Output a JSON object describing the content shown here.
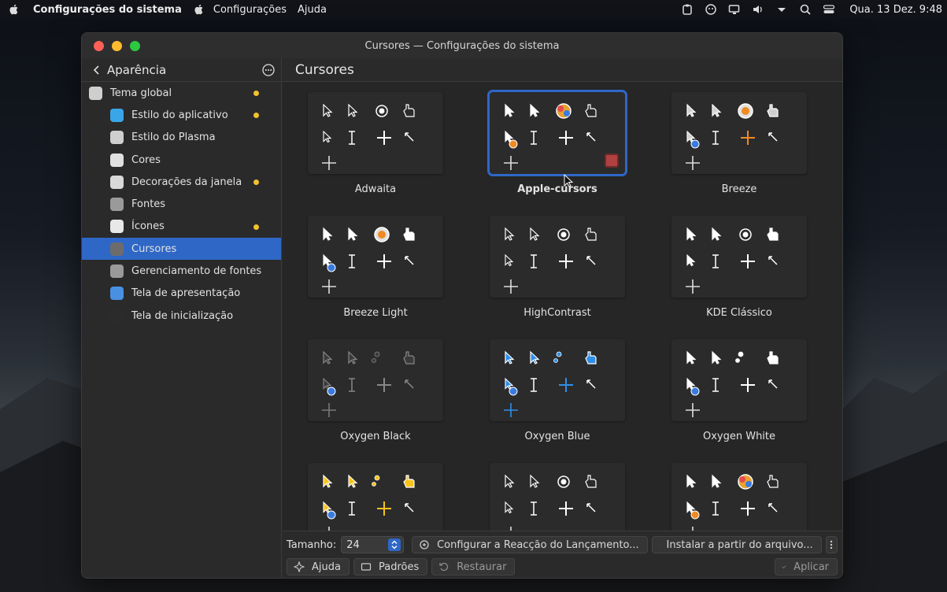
{
  "menubar": {
    "app_name": "Configurações do sistema",
    "menus": [
      "Configurações",
      "Ajuda"
    ],
    "clock": "Qua. 13 Dez. 9:48"
  },
  "window": {
    "title": "Cursores — Configurações do sistema"
  },
  "sidebar": {
    "back_label": "Aparência",
    "items": [
      {
        "label": "Tema global",
        "icon": "global-theme-icon",
        "color": "#cfcfcf",
        "dot": true,
        "level": 0
      },
      {
        "label": "Estilo do aplicativo",
        "icon": "app-style-icon",
        "color": "#3aa6e8",
        "dot": true,
        "level": 1
      },
      {
        "label": "Estilo do Plasma",
        "icon": "plasma-style-icon",
        "color": "#cfcfcf",
        "dot": false,
        "level": 1
      },
      {
        "label": "Cores",
        "icon": "colors-icon",
        "color": "#e0e0e0",
        "dot": false,
        "level": 1
      },
      {
        "label": "Decorações da janela",
        "icon": "window-decoration-icon",
        "color": "#d9d9d9",
        "dot": true,
        "level": 1
      },
      {
        "label": "Fontes",
        "icon": "fonts-icon",
        "color": "#9a9a9a",
        "dot": false,
        "level": 1
      },
      {
        "label": "Ícones",
        "icon": "icons-icon",
        "color": "#e8e8e8",
        "dot": true,
        "level": 1
      },
      {
        "label": "Cursores",
        "icon": "cursors-icon",
        "color": "#6c6c6c",
        "dot": false,
        "level": 1,
        "active": true
      },
      {
        "label": "Gerenciamento de fontes",
        "icon": "font-management-icon",
        "color": "#9a9a9a",
        "dot": false,
        "level": 1
      },
      {
        "label": "Tela de apresentação",
        "icon": "splash-screen-icon",
        "color": "#4a90e2",
        "dot": false,
        "level": 1
      },
      {
        "label": "Tela de inicialização",
        "icon": "boot-screen-icon",
        "color": "#2b2b2b",
        "dot": false,
        "level": 1
      }
    ]
  },
  "main": {
    "heading": "Cursores",
    "themes": [
      {
        "name": "Adwaita",
        "style": "outline",
        "accent": "#ffffff"
      },
      {
        "name": "Apple-cursors",
        "style": "apple",
        "accent": "#ffffff",
        "selected": true
      },
      {
        "name": "Breeze",
        "style": "breeze",
        "accent": "#cfcfcf"
      },
      {
        "name": "Breeze Light",
        "style": "breeze-light",
        "accent": "#ffffff"
      },
      {
        "name": "HighContrast",
        "style": "outline",
        "accent": "#ffffff"
      },
      {
        "name": "KDE Clássico",
        "style": "classic",
        "accent": "#ffffff"
      },
      {
        "name": "Oxygen Black",
        "style": "oxygen",
        "accent": "#3a3a3a"
      },
      {
        "name": "Oxygen Blue",
        "style": "oxygen",
        "accent": "#2f8ee8"
      },
      {
        "name": "Oxygen White",
        "style": "oxygen",
        "accent": "#ffffff"
      },
      {
        "name": "",
        "style": "oxygen",
        "accent": "#f6c21c"
      },
      {
        "name": "",
        "style": "outline2",
        "accent": "#ffffff"
      },
      {
        "name": "",
        "style": "apple",
        "accent": "#ffffff"
      }
    ]
  },
  "footer": {
    "size_label": "Tamanho:",
    "size_value": "24",
    "launch_feedback_label": "Configurar a Reacção do Lançamento...",
    "install_label": "Instalar a partir do arquivo...",
    "help_label": "Ajuda",
    "defaults_label": "Padrões",
    "reset_label": "Restaurar",
    "apply_label": "Aplicar"
  }
}
